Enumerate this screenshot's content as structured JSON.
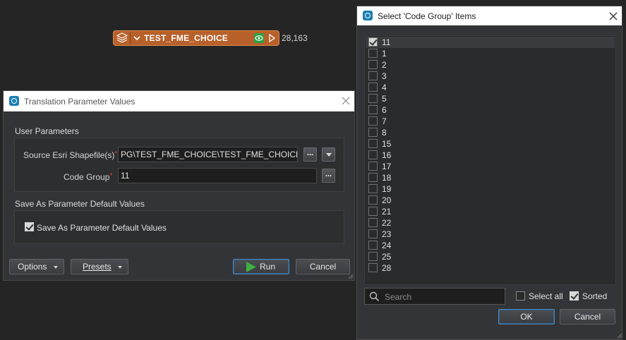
{
  "canvas": {
    "node_title": "TEST_FME_CHOICE",
    "feature_count": "28,163",
    "node_color": "#b8602a"
  },
  "translation_dialog": {
    "title": "Translation Parameter Values",
    "user_params_label": "User Parameters",
    "source_label": "Source Esri Shapefile(s)",
    "source_value": "PG\\TEST_FME_CHOICE\\TEST_FME_CHOICE.shp",
    "code_group_label": "Code Group",
    "code_group_value": "11",
    "browse_label": "...",
    "save_section_label": "Save As Parameter Default Values",
    "save_checkbox_label": "Save As Parameter Default Values",
    "save_checked": true,
    "options_label": "Options",
    "presets_label": "Presets",
    "run_label": "Run",
    "cancel_label": "Cancel"
  },
  "code_group_dialog": {
    "title": "Select 'Code Group' Items",
    "items": [
      {
        "label": "11",
        "checked": true
      },
      {
        "label": "1",
        "checked": false
      },
      {
        "label": "2",
        "checked": false
      },
      {
        "label": "3",
        "checked": false
      },
      {
        "label": "4",
        "checked": false
      },
      {
        "label": "5",
        "checked": false
      },
      {
        "label": "6",
        "checked": false
      },
      {
        "label": "7",
        "checked": false
      },
      {
        "label": "8",
        "checked": false
      },
      {
        "label": "15",
        "checked": false
      },
      {
        "label": "16",
        "checked": false
      },
      {
        "label": "17",
        "checked": false
      },
      {
        "label": "18",
        "checked": false
      },
      {
        "label": "19",
        "checked": false
      },
      {
        "label": "20",
        "checked": false
      },
      {
        "label": "21",
        "checked": false
      },
      {
        "label": "22",
        "checked": false
      },
      {
        "label": "23",
        "checked": false
      },
      {
        "label": "24",
        "checked": false
      },
      {
        "label": "25",
        "checked": false
      },
      {
        "label": "28",
        "checked": false
      }
    ],
    "search_placeholder": "Search",
    "select_all_label": "Select all",
    "select_all_checked": false,
    "sorted_label": "Sorted",
    "sorted_checked": true,
    "ok_label": "OK",
    "cancel_label": "Cancel"
  }
}
